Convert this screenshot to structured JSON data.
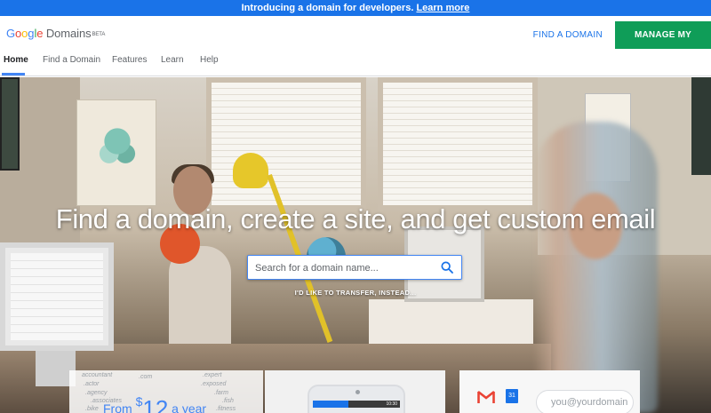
{
  "announcement": {
    "lead": "Introducing a domain for developers.",
    "link": "Learn more"
  },
  "header": {
    "logo": {
      "google": "Google",
      "domains": "Domains",
      "beta": "BETA"
    },
    "find_domain": "FIND A DOMAIN",
    "manage_domains": "MANAGE MY DOMAINS"
  },
  "nav": {
    "items": [
      {
        "label": "Home"
      },
      {
        "label": "Find a Domain"
      },
      {
        "label": "Features"
      },
      {
        "label": "Learn"
      },
      {
        "label": "Help"
      }
    ]
  },
  "hero": {
    "title": "Find a domain, create a site, and get custom email",
    "search": {
      "placeholder": "Search for a domain name..."
    },
    "transfer_link": "I'D LIKE TO TRANSFER, INSTEAD..."
  },
  "cards": {
    "pricing": {
      "words": [
        "accountant",
        ".actor",
        ".agency",
        ".associates",
        ".bike",
        ".com",
        ".expert",
        ".exposed",
        ".farm",
        ".fish",
        ".fitness"
      ],
      "from": "From",
      "currency": "$",
      "price": "12",
      "per": "a year"
    },
    "phone": {
      "status_time": "10:30"
    },
    "email": {
      "calendar_day": "31",
      "placeholder": "you@yourdomain"
    }
  },
  "colors": {
    "brand_blue": "#1a73e8",
    "manage_green": "#0f9d58",
    "announce_bg": "#1a73e8"
  }
}
